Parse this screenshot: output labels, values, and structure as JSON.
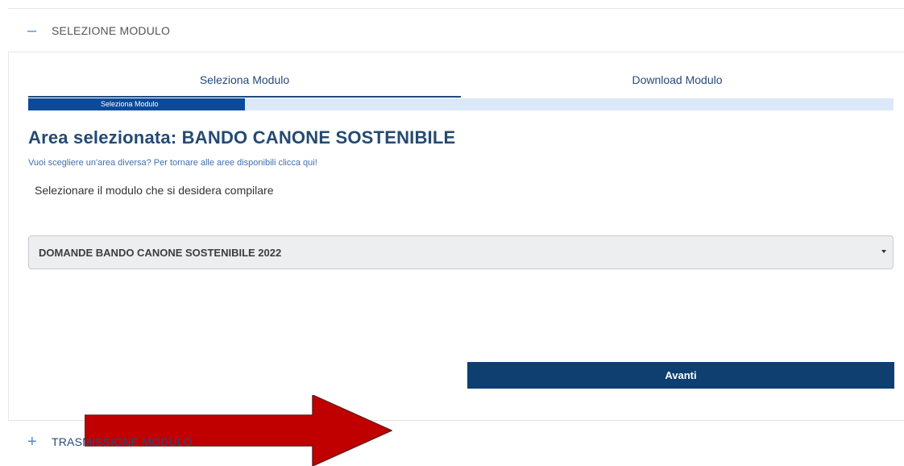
{
  "sections": {
    "first": {
      "sign": "–",
      "title": "SELEZIONE MODULO"
    },
    "second": {
      "sign": "+",
      "title": "TRASMISSIONE MODULO"
    }
  },
  "tabs": [
    {
      "label": "Seleziona Modulo",
      "active": true
    },
    {
      "label": "Download Modulo",
      "active": false
    }
  ],
  "progress": {
    "label": "Seleziona Modulo",
    "fraction": 0.25
  },
  "area": {
    "title": "Area selezionata: BANDO CANONE SOSTENIBILE",
    "link": "Vuoi scegliere un'area diversa? Per tornare alle aree disponibili clicca qui!",
    "instruction": "Selezionare il modulo che si desidera compilare"
  },
  "select": {
    "value": "DOMANDE BANDO CANONE SOSTENIBILE 2022"
  },
  "buttons": {
    "next": "Avanti"
  },
  "annotation": {
    "icon": "red-arrow-icon",
    "color": "#c00000"
  },
  "colors": {
    "primary": "#0e3f70",
    "progress": "#0b4a99",
    "progress_track": "#dbe8f7",
    "link": "#3f6fb0"
  }
}
